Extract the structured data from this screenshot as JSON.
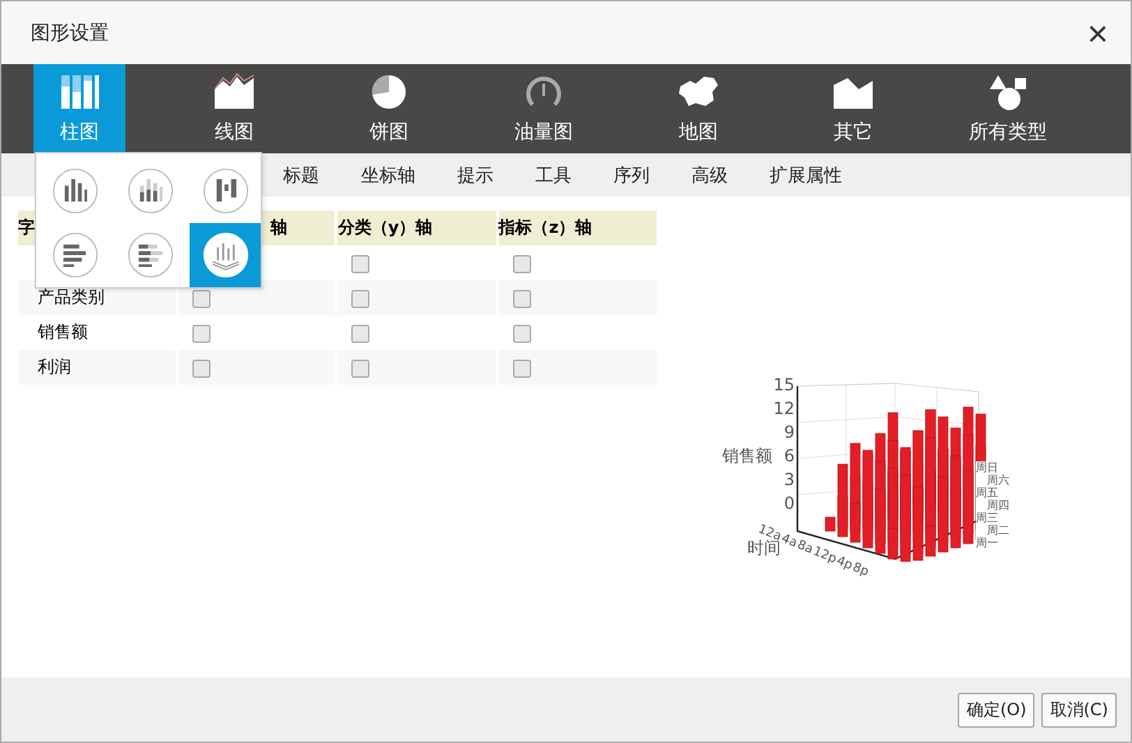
{
  "window": {
    "title": "图形设置",
    "close": "×"
  },
  "chart_types": [
    {
      "label": "柱图",
      "selected": true
    },
    {
      "label": "线图",
      "selected": false
    },
    {
      "label": "饼图",
      "selected": false
    },
    {
      "label": "油量图",
      "selected": false
    },
    {
      "label": "地图",
      "selected": false
    },
    {
      "label": "其它",
      "selected": false
    },
    {
      "label": "所有类型",
      "selected": false
    }
  ],
  "subtypes": [
    {
      "selected": false
    },
    {
      "selected": false
    },
    {
      "selected": false
    },
    {
      "selected": false
    },
    {
      "selected": false
    },
    {
      "selected": true
    }
  ],
  "settings_tabs": [
    {
      "label": "标题",
      "selected": false
    },
    {
      "label": "坐标轴",
      "selected": false
    },
    {
      "label": "提示",
      "selected": false
    },
    {
      "label": "工具",
      "selected": false
    },
    {
      "label": "序列",
      "selected": false
    },
    {
      "label": "高级",
      "selected": false
    },
    {
      "label": "扩展属性",
      "selected": false
    }
  ],
  "table": {
    "columns": [
      "字",
      "轴",
      "分类（y）轴",
      "指标（z）轴"
    ],
    "rows": [
      {
        "field": null,
        "cells": [
          null,
          {
            "checked": false
          },
          {
            "checked": false
          }
        ]
      },
      {
        "field": "产品类别",
        "cells": [
          {
            "checked": false
          },
          {
            "checked": false
          },
          {
            "checked": false
          }
        ]
      },
      {
        "field": "销售额",
        "cells": [
          {
            "checked": false
          },
          {
            "checked": false
          },
          {
            "checked": false
          }
        ]
      },
      {
        "field": "利润",
        "cells": [
          {
            "checked": false
          },
          {
            "checked": false
          },
          {
            "checked": false
          }
        ]
      }
    ]
  },
  "preview": {
    "z_label": "销售额",
    "z_ticks": [
      "15",
      "12",
      "9",
      "6",
      "3",
      "0"
    ],
    "x_label": "时间",
    "x_ticks": [
      "12a",
      "4a",
      "8a",
      "12p",
      "4p",
      "8p"
    ],
    "y_ticks": [
      "周日",
      "周六",
      "周五",
      "周四",
      "周三",
      "周二",
      "周一"
    ]
  },
  "buttons": [
    "确定(O)",
    "取消(C)"
  ]
}
